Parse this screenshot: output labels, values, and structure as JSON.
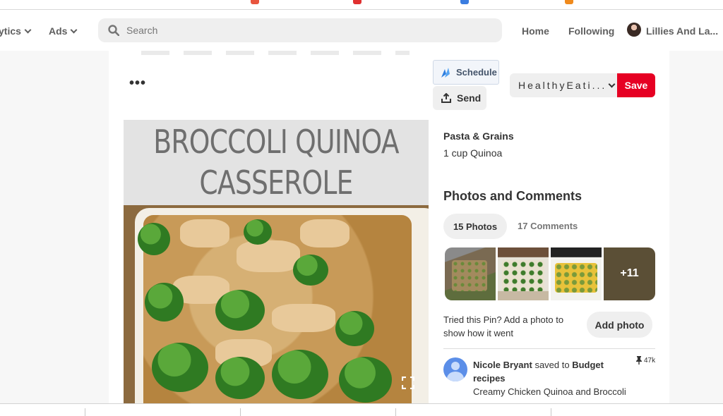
{
  "nav": {
    "analytics_label": "ytics",
    "ads_label": "Ads",
    "search_placeholder": "Search",
    "home_label": "Home",
    "following_label": "Following",
    "profile_name": "Lillies And La..."
  },
  "pin": {
    "schedule_label": "Schedule",
    "send_label": "Send",
    "board_name": "HealthyEati...",
    "save_label": "Save",
    "image_title_line1": "BROCCOLI QUINOA",
    "image_title_line2": "CASSEROLE"
  },
  "details": {
    "section_label": "Pasta & Grains",
    "ingredient": "1 cup Quinoa",
    "photos_comments_heading": "Photos and Comments",
    "tab_photos": "15 Photos",
    "tab_comments": "17 Comments",
    "more_photos": "+11",
    "tried_text": "Tried this Pin? Add a photo to show how it went",
    "add_photo_label": "Add photo"
  },
  "activity": {
    "user_name": "Nicole Bryant",
    "saved_to_text": "saved to",
    "board": "Budget recipes",
    "saves_count": "47k",
    "description": "Creamy Chicken Quinoa and Broccoli"
  }
}
